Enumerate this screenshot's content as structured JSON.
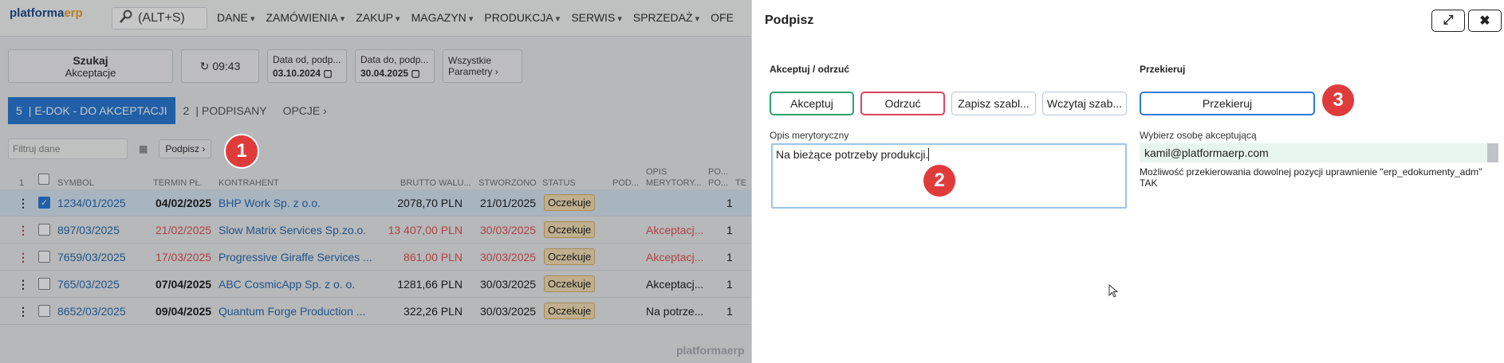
{
  "app": {
    "logo_main": "platforma",
    "logo_erp": "erp",
    "search_shortcut": "(ALT+S)",
    "menu": [
      "DANE",
      "ZAMÓWIENIA",
      "ZAKUP",
      "MAGAZYN",
      "PRODUKCJA",
      "SERWIS",
      "SPRZEDAŻ",
      "OFE"
    ],
    "watermark": "platformaerp"
  },
  "toolbar": {
    "search_title": "Szukaj",
    "search_sub": "Akceptacje",
    "refresh_time": "09:43",
    "date_from_label": "Data od, podp...",
    "date_from_value": "03.10.2024",
    "date_to_label": "Data do, podp...",
    "date_to_value": "30.04.2025",
    "params_line1": "Wszystkie",
    "params_line2": "Parametry"
  },
  "tabs": [
    {
      "count": "5",
      "label": "E-DOK - DO AKCEPTACJI"
    },
    {
      "count": "2",
      "label": "PODPISANY"
    },
    {
      "count": "",
      "label": "OPCJE"
    }
  ],
  "filter": {
    "placeholder": "Filtruj dane",
    "chip": "Podpisz"
  },
  "table": {
    "headers": {
      "n": "1",
      "symbol": "SYMBOL",
      "termin": "TERMIN PŁ.",
      "kontrahent": "KONTRAHENT",
      "brutto": "BRUTTO WALU...",
      "stworzono": "STWORZONO",
      "status": "STATUS",
      "pod": "POD...",
      "opis1": "OPIS",
      "opis2": "MERYTORY...",
      "po1": "PO...",
      "po2": "PO...",
      "te": "TE"
    },
    "rows": [
      {
        "symbol": "1234/01/2025",
        "termin": "04/02/2025",
        "kontrahent": "BHP Work Sp. z o.o.",
        "brutto": "2078,70 PLN",
        "stworzono": "21/01/2025",
        "status": "Oczekuje",
        "opis": "",
        "num": "1",
        "selected": true,
        "overdue": false
      },
      {
        "symbol": "897/03/2025",
        "termin": "21/02/2025",
        "kontrahent": "Slow Matrix Services Sp.zo.o.",
        "brutto": "13 407,00 PLN",
        "stworzono": "30/03/2025",
        "status": "Oczekuje",
        "opis": "Akceptacj...",
        "num": "1",
        "selected": false,
        "overdue": true
      },
      {
        "symbol": "7659/03/2025",
        "termin": "17/03/2025",
        "kontrahent": "Progressive Giraffe Services ...",
        "brutto": "861,00 PLN",
        "stworzono": "30/03/2025",
        "status": "Oczekuje",
        "opis": "Akceptacj...",
        "num": "1",
        "selected": false,
        "overdue": true
      },
      {
        "symbol": "765/03/2025",
        "termin": "07/04/2025",
        "kontrahent": "ABC CosmicApp Sp. z o. o.",
        "brutto": "1281,66 PLN",
        "stworzono": "30/03/2025",
        "status": "Oczekuje",
        "opis": "Akceptacj...",
        "num": "1",
        "selected": false,
        "overdue": false
      },
      {
        "symbol": "8652/03/2025",
        "termin": "09/04/2025",
        "kontrahent": "Quantum Forge Production ...",
        "brutto": "322,26 PLN",
        "stworzono": "30/03/2025",
        "status": "Oczekuje",
        "opis": "Na potrze...",
        "num": "1",
        "selected": false,
        "overdue": false
      }
    ]
  },
  "panel": {
    "title": "Podpisz",
    "accept_section": "Akceptuj / odrzuć",
    "accept_btn": "Akceptuj",
    "reject_btn": "Odrzuć",
    "save_tpl_btn": "Zapisz szabl...",
    "load_tpl_btn": "Wczytaj szab...",
    "desc_label": "Opis merytoryczny",
    "desc_value": "Na bieżące potrzeby produkcji.",
    "redirect_section": "Przekieruj",
    "redirect_btn": "Przekieruj",
    "person_label": "Wybierz osobę akceptującą",
    "person_value": "kamil@platformaerp.com",
    "note": "Możliwość przekierowania dowolnej pozycji uprawnienie \"erp_edokumenty_adm\"",
    "note_value": "TAK"
  },
  "badges": [
    "1",
    "2",
    "3"
  ],
  "colors": {
    "accent_blue": "#2b7bd6",
    "accept_green": "#2fa36b",
    "reject_red": "#d9455f",
    "badge_red": "#e03b3b",
    "status_bg": "#f5e1b8"
  }
}
